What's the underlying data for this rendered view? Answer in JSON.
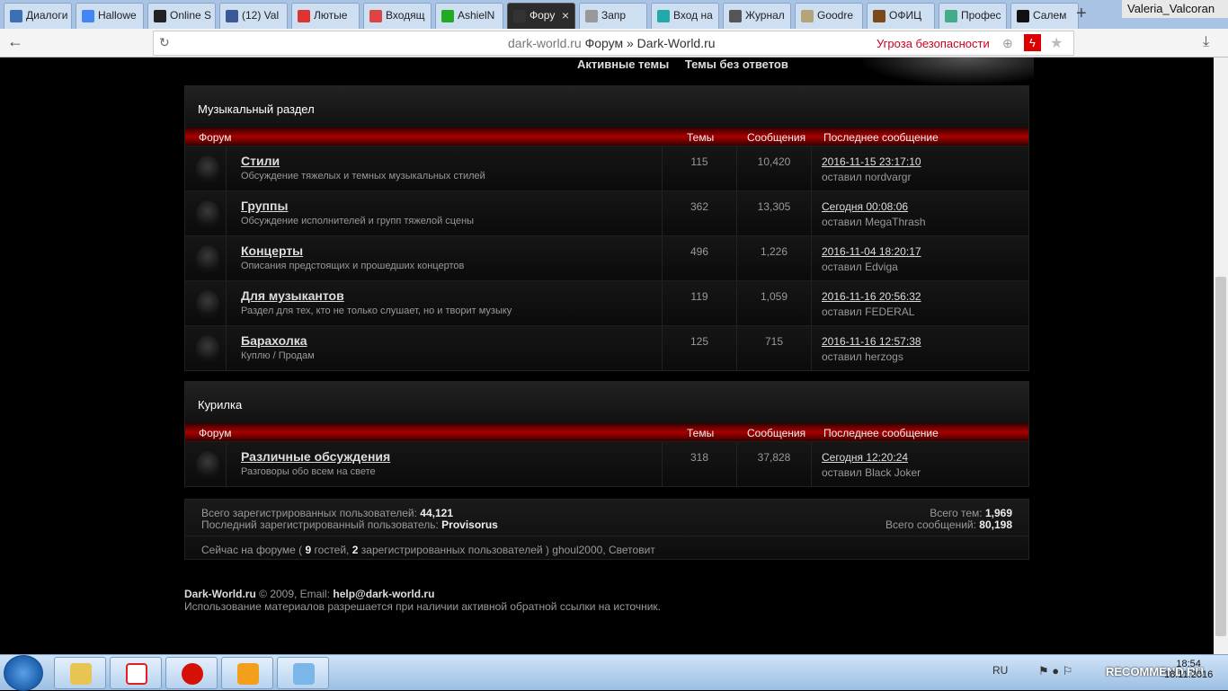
{
  "browser": {
    "tabs": [
      {
        "title": "Диалоги",
        "color": "#3b6fb6"
      },
      {
        "title": "Hallowe",
        "color": "#4285f4"
      },
      {
        "title": "Online S",
        "color": "#222222"
      },
      {
        "title": "(12) Val",
        "color": "#3b5998"
      },
      {
        "title": "Лютые",
        "color": "#d33"
      },
      {
        "title": "Входящ",
        "color": "#d44"
      },
      {
        "title": "AshielN",
        "color": "#2a2"
      },
      {
        "title": "Фору",
        "color": "#333",
        "active": true
      },
      {
        "title": "Запр",
        "color": "#999"
      },
      {
        "title": "Вход на",
        "color": "#2aa"
      },
      {
        "title": "Журнал",
        "color": "#555"
      },
      {
        "title": "Goodre",
        "color": "#b5a37a"
      },
      {
        "title": "ОФИЦ",
        "color": "#7a4a1a"
      },
      {
        "title": "Профес",
        "color": "#4a8"
      },
      {
        "title": "Салем",
        "color": "#111"
      }
    ],
    "new_tab": "+",
    "user_name": "Valeria_Valcoran",
    "url_domain": "dark-world.ru",
    "url_title": "Форум » Dark-World.ru",
    "threat": "Угроза безопасности"
  },
  "nav": {
    "active_topics": "Активные темы",
    "unanswered": "Темы без ответов"
  },
  "music": {
    "title": "Музыкальный раздел",
    "headers": {
      "forum": "Форум",
      "topics": "Темы",
      "posts": "Сообщения",
      "last": "Последнее сообщение"
    },
    "rows": [
      {
        "name": "Стили",
        "desc": "Обсуждение тяжелых и темных музыкальных стилей",
        "topics": "115",
        "posts": "10,420",
        "date": "2016-11-15 23:17:10",
        "by": "оставил nordvargr"
      },
      {
        "name": "Группы",
        "desc": "Обсуждение исполнителей и групп тяжелой сцены",
        "topics": "362",
        "posts": "13,305",
        "date": "Сегодня 00:08:06",
        "by": "оставил MegaThrash"
      },
      {
        "name": "Концерты",
        "desc": "Описания предстоящих и прошедших концертов",
        "topics": "496",
        "posts": "1,226",
        "date": "2016-11-04 18:20:17",
        "by": "оставил Edviga"
      },
      {
        "name": "Для музыкантов",
        "desc": "Раздел для тех, кто не только слушает, но и творит музыку",
        "topics": "119",
        "posts": "1,059",
        "date": "2016-11-16 20:56:32",
        "by": "оставил FEDERAL"
      },
      {
        "name": "Барахолка",
        "desc": "Куплю / Продам",
        "topics": "125",
        "posts": "715",
        "date": "2016-11-16 12:57:38",
        "by": "оставил herzogs"
      }
    ]
  },
  "smoke": {
    "title": "Курилка",
    "headers": {
      "forum": "Форум",
      "topics": "Темы",
      "posts": "Сообщения",
      "last": "Последнее сообщение"
    },
    "rows": [
      {
        "name": "Различные обсуждения",
        "desc": "Разговоры обо всем на свете",
        "topics": "318",
        "posts": "37,828",
        "date": "Сегодня 12:20:24",
        "by": "оставил Black Joker"
      }
    ]
  },
  "stats": {
    "users_label": "Всего зарегистрированных пользователей:",
    "users": "44,121",
    "last_user_label": "Последний зарегистрированный пользователь:",
    "last_user": "Provisorus",
    "topics_label": "Всего тем:",
    "topics": "1,969",
    "posts_label": "Всего сообщений:",
    "posts": "80,198",
    "online_prefix": "Сейчас на форуме (",
    "guests": "9",
    "guests_label": "гостей,",
    "registered": "2",
    "registered_label": "зарегистрированных пользователей )",
    "online_users": "ghoul2000, Световит"
  },
  "footer": {
    "site": "Dark-World.ru",
    "copy": "© 2009, Email:",
    "email": "help@dark-world.ru",
    "notice": "Использование материалов разрешается при наличии активной обратной ссылки на источник."
  },
  "taskbar": {
    "lang": "RU",
    "time": "18:54",
    "date": "18.11.2016",
    "watermark": "RECOMMEND.RU"
  }
}
